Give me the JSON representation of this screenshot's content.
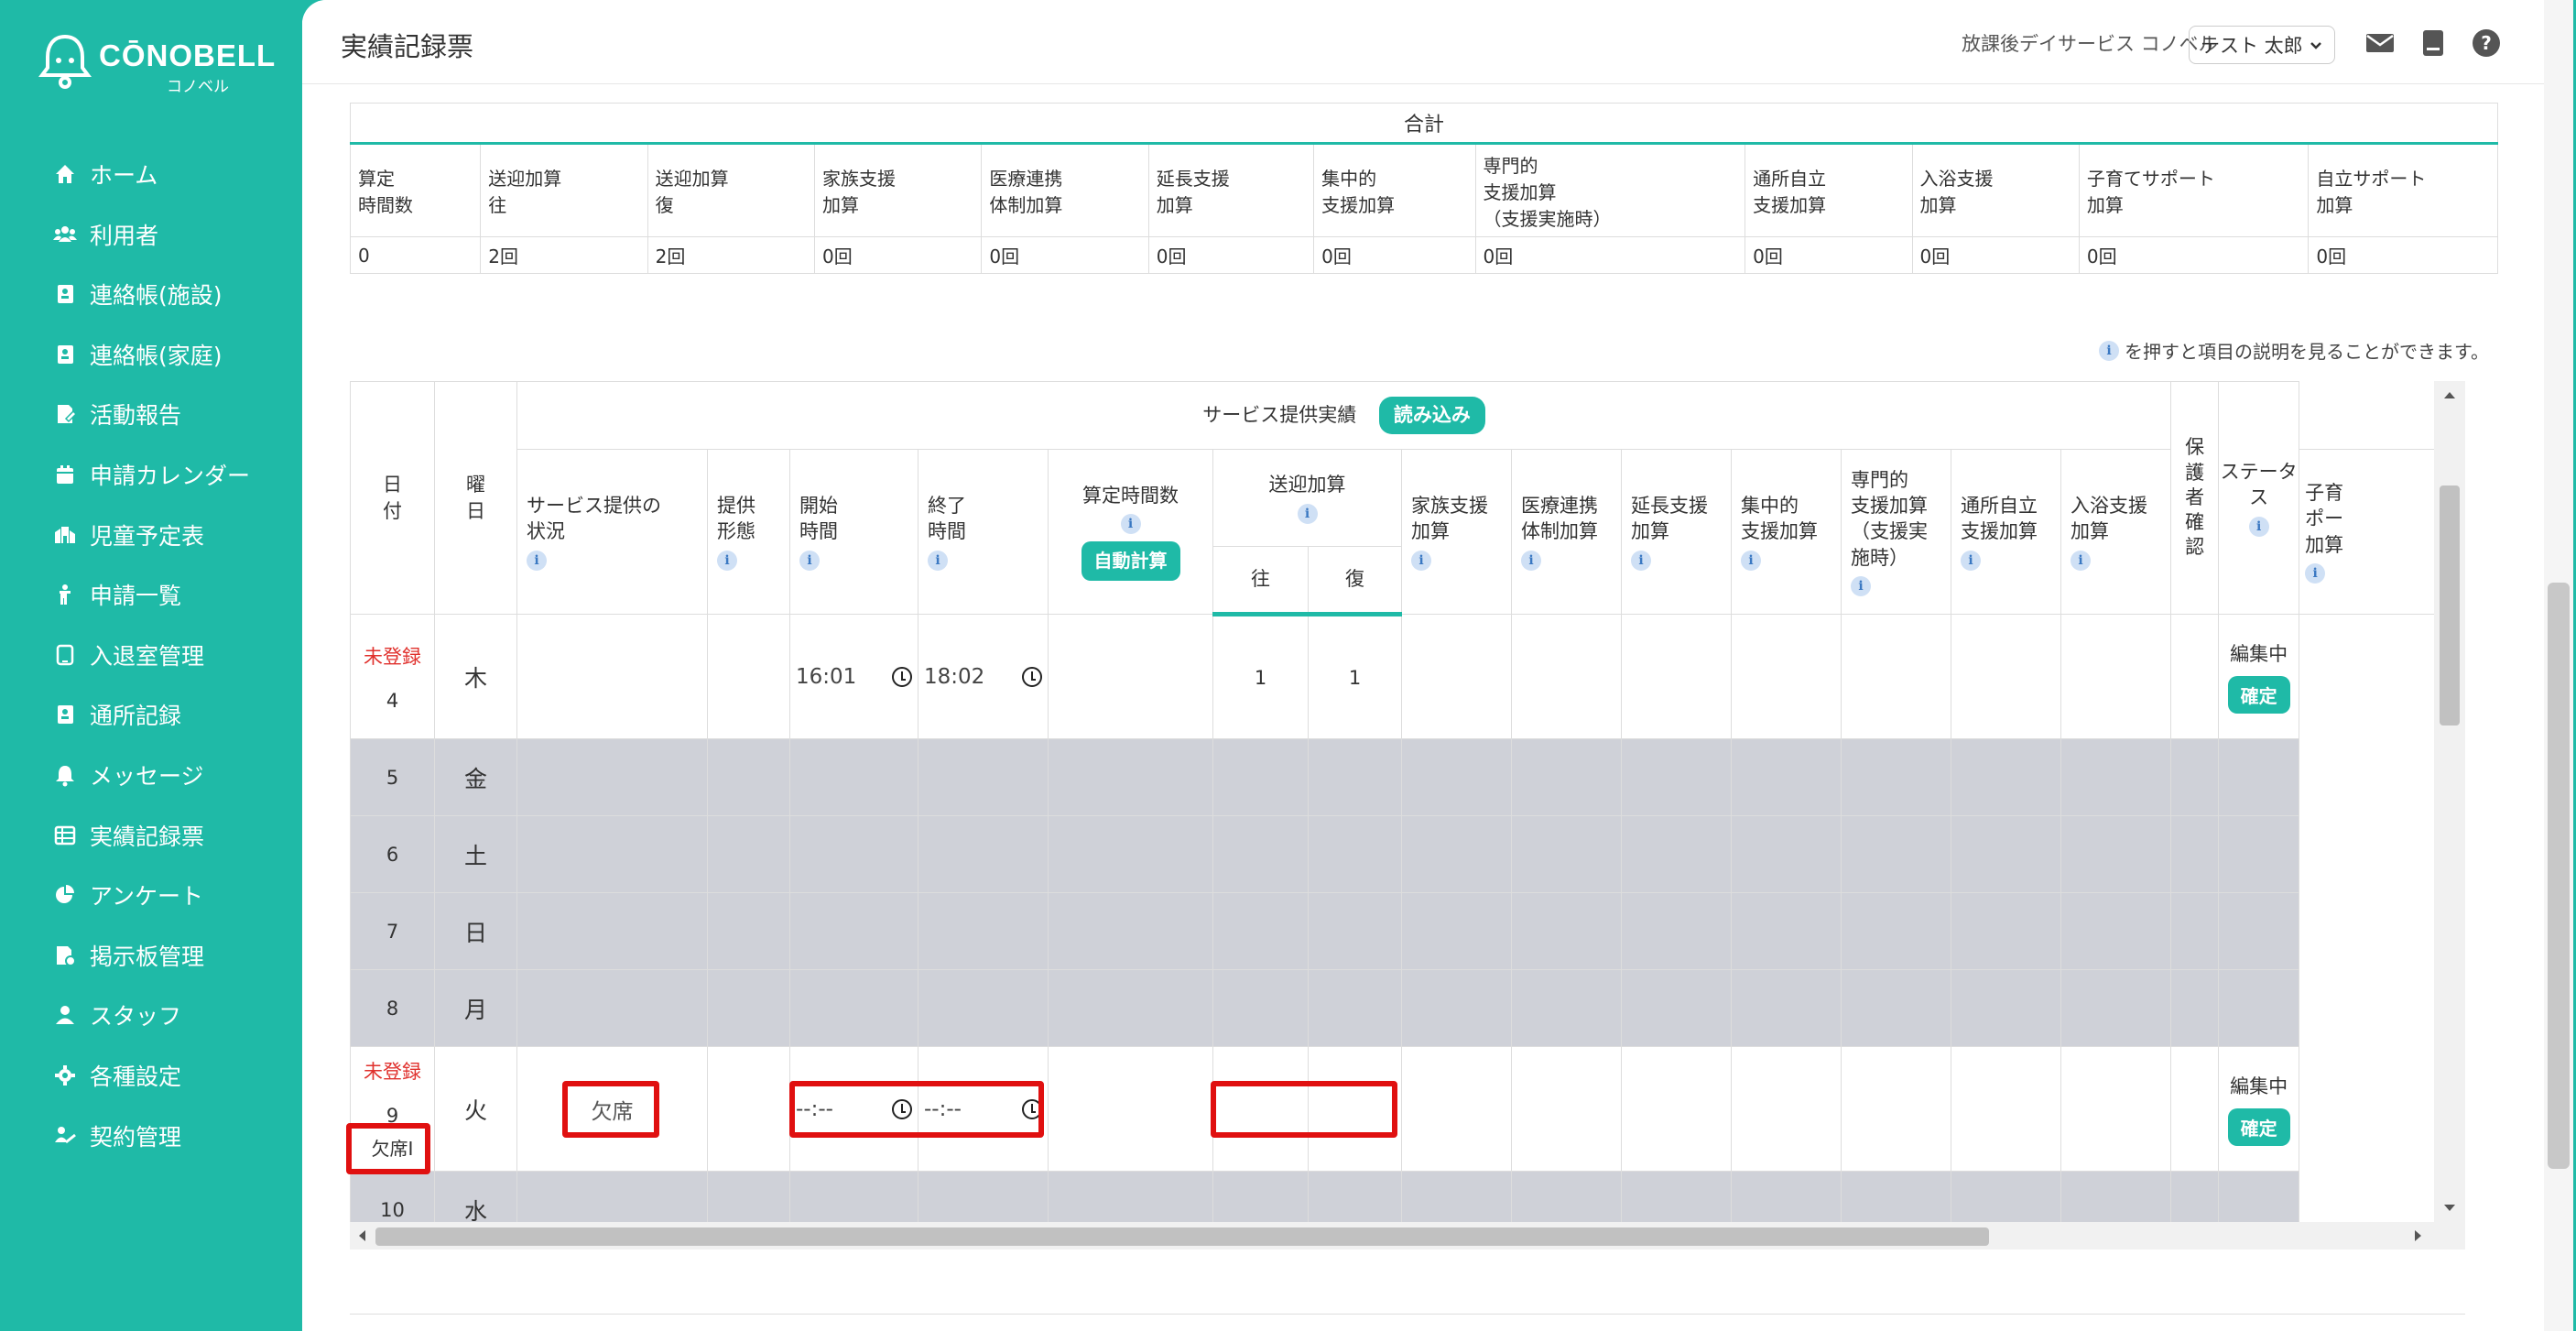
{
  "brand": {
    "name": "CŌNOBELL",
    "sub": "コノベル"
  },
  "nav": [
    {
      "label": "ホーム",
      "icon": "home-icon"
    },
    {
      "label": "利用者",
      "icon": "users-icon"
    },
    {
      "label": "連絡帳(施設)",
      "icon": "contact-book-icon"
    },
    {
      "label": "連絡帳(家庭)",
      "icon": "contact-book-icon"
    },
    {
      "label": "活動報告",
      "icon": "report-icon"
    },
    {
      "label": "申請カレンダー",
      "icon": "calendar-icon"
    },
    {
      "label": "児童予定表",
      "icon": "schedule-icon"
    },
    {
      "label": "申請一覧",
      "icon": "child-icon"
    },
    {
      "label": "入退室管理",
      "icon": "tablet-icon"
    },
    {
      "label": "通所記録",
      "icon": "record-icon"
    },
    {
      "label": "メッセージ",
      "icon": "bell-icon"
    },
    {
      "label": "実績記録票",
      "icon": "table-icon"
    },
    {
      "label": "アンケート",
      "icon": "pie-icon"
    },
    {
      "label": "掲示板管理",
      "icon": "board-icon"
    },
    {
      "label": "スタッフ",
      "icon": "staff-icon"
    },
    {
      "label": "各種設定",
      "icon": "gear-icon"
    },
    {
      "label": "契約管理",
      "icon": "contract-icon"
    }
  ],
  "header": {
    "title": "実績記録票",
    "facility": "放課後デイサービス コノベル",
    "user": "テスト 太郎"
  },
  "totals": {
    "caption": "合計",
    "headers": [
      [
        "算定",
        "時間数"
      ],
      [
        "送迎加算",
        "往"
      ],
      [
        "送迎加算",
        "復"
      ],
      [
        "家族支援",
        "加算"
      ],
      [
        "医療連携",
        "体制加算"
      ],
      [
        "延長支援",
        "加算"
      ],
      [
        "集中的",
        "支援加算"
      ],
      [
        "専門的",
        "支援加算",
        "（支援実施時）"
      ],
      [
        "通所自立",
        "支援加算"
      ],
      [
        "入浴支援",
        "加算"
      ],
      [
        "子育てサポート",
        "加算"
      ],
      [
        "自立サポート",
        "加算"
      ]
    ],
    "values": [
      "0",
      "2回",
      "2回",
      "0回",
      "0回",
      "0回",
      "0回",
      "0回",
      "0回",
      "0回",
      "0回",
      "0回"
    ]
  },
  "info_note": "を押すと項目の説明を見ることができます。",
  "grid": {
    "service_group": "サービス提供実績",
    "read_button": "読み込み",
    "auto_calc_button": "自動計算",
    "headers": {
      "date": [
        "日",
        "付"
      ],
      "weekday": [
        "曜",
        "日"
      ],
      "status": [
        "サービス提供の",
        "状況"
      ],
      "form": [
        "提供",
        "形態"
      ],
      "start": [
        "開始",
        "時間"
      ],
      "end": [
        "終了",
        "時間"
      ],
      "calc": "算定時間数",
      "transport": "送迎加算",
      "go": "往",
      "back": "復",
      "family": [
        "家族支援",
        "加算"
      ],
      "medical": [
        "医療連携",
        "体制加算"
      ],
      "extend": [
        "延長支援",
        "加算"
      ],
      "intensive": [
        "集中的",
        "支援加算"
      ],
      "special": [
        "専門的",
        "支援加算",
        "（支援実",
        "施時）"
      ],
      "self": [
        "通所自立",
        "支援加算"
      ],
      "bath": [
        "入浴支援",
        "加算"
      ],
      "child": [
        "子育",
        "ポー",
        "加算"
      ],
      "guardian": [
        "保",
        "護",
        "者",
        "確",
        "認"
      ],
      "stat": "ステータス"
    },
    "rows": [
      {
        "unreg": "未登録",
        "day": "4",
        "wd": "木",
        "start": "16:01",
        "end": "18:02",
        "go": "1",
        "back": "1",
        "status": "編集中",
        "confirm": "確定"
      },
      {
        "day": "5",
        "wd": "金"
      },
      {
        "day": "6",
        "wd": "土"
      },
      {
        "day": "7",
        "wd": "日"
      },
      {
        "day": "8",
        "wd": "月"
      },
      {
        "unreg": "未登録",
        "day": "9",
        "wd": "火",
        "badge": "欠席Ⅰ",
        "svc": "欠席",
        "start": "--:--",
        "end": "--:--",
        "status": "編集中",
        "confirm": "確定"
      },
      {
        "day": "10",
        "wd": "水"
      }
    ]
  },
  "colors": {
    "accent": "#1fbaa7",
    "unregistered": "#e0302c",
    "highlight": "#e01010"
  }
}
